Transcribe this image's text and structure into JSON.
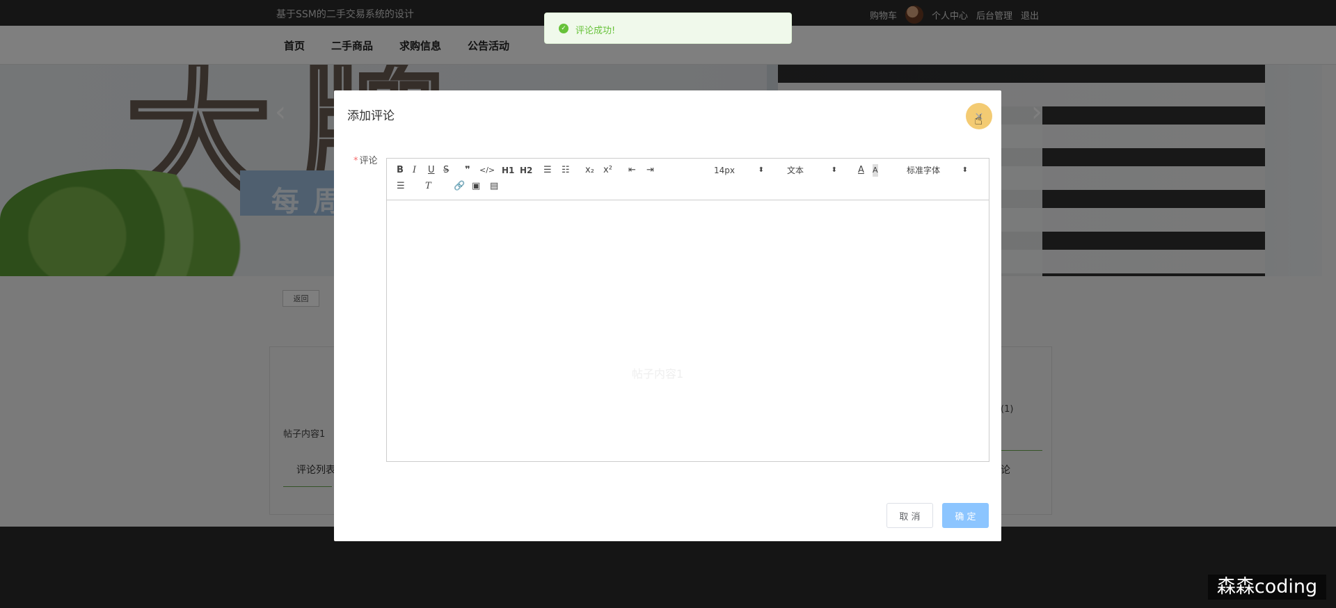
{
  "site": {
    "title": "基于SSM的二手交易系统的设计"
  },
  "topbar": {
    "cart": "购物车",
    "profile": "个人中心",
    "admin": "后台管理",
    "logout": "退出"
  },
  "nav": [
    "首页",
    "二手商品",
    "求购信息",
    "公告活动"
  ],
  "banner": {
    "big_text": "大牌",
    "box_text": "每周"
  },
  "page": {
    "back_label": "返回",
    "post_content": "帖子内容1",
    "comment_list_label": "评论列表",
    "count_label": "(1)",
    "comment_right_label": "论"
  },
  "modal": {
    "title": "添加评论",
    "field_label": "评论",
    "required_mark": "*",
    "placeholder": "帖子内容1",
    "cancel": "取 消",
    "confirm": "确 定"
  },
  "editor_toolbar": {
    "font_size": "14px",
    "heading": "文本",
    "font_family": "标准字体",
    "h1": "H1",
    "h2": "H2"
  },
  "toast": {
    "message": "评论成功!"
  },
  "watermark": {
    "text": "森森coding"
  },
  "colors": {
    "success": "#67c23a",
    "primary_light": "#8cc5ff",
    "topbar_bg": "#2b2b2b"
  }
}
